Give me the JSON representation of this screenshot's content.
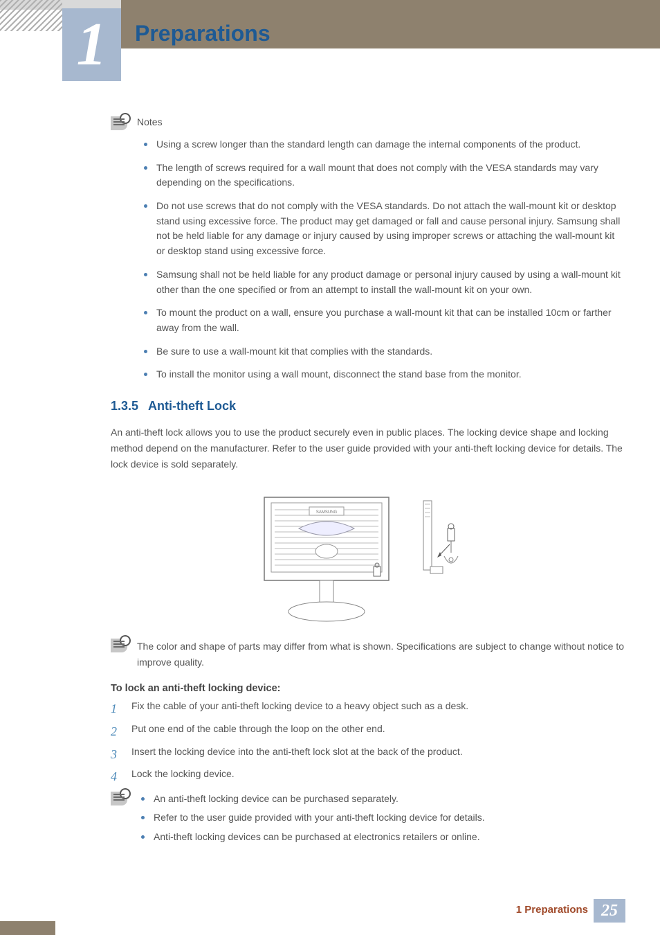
{
  "header": {
    "chapter_number": "1",
    "chapter_title": "Preparations"
  },
  "notes_block": {
    "label": "Notes",
    "icon": "note-icon",
    "items": [
      "Using a screw longer than the standard length can damage the internal components of the product.",
      "The length of screws required for a wall mount that does not comply with the VESA standards may vary depending on the specifications.",
      "Do not use screws that do not comply with the VESA standards. Do not attach the wall-mount kit or desktop stand using excessive force. The product may get damaged or fall and cause personal injury. Samsung shall not be held liable for any damage or injury caused by using improper screws or attaching the wall-mount kit or desktop stand using excessive force.",
      "Samsung shall not be held liable for any product damage or personal injury caused by using a wall-mount kit other than the one specified or from an attempt to install the wall-mount kit on your own.",
      "To mount the product on a wall, ensure you purchase a wall-mount kit that can be installed 10cm or farther away from the wall.",
      "Be sure to use a wall-mount kit that complies with the standards.",
      "To install the monitor using a wall mount, disconnect the stand base from the monitor."
    ]
  },
  "section": {
    "number": "1.3.5",
    "title": "Anti-theft Lock",
    "intro": "An anti-theft lock allows you to use the product securely even in public places. The locking device shape and locking method depend on the manufacturer. Refer to the user guide provided with your anti-theft locking device for details. The lock device is sold separately.",
    "diagram_note": "The color and shape of parts may differ from what is shown. Specifications are subject to change without notice to improve quality.",
    "subheading": "To lock an anti-theft locking device:",
    "steps": [
      {
        "n": "1",
        "t": "Fix the cable of your anti-theft locking device to a heavy object such as a desk."
      },
      {
        "n": "2",
        "t": "Put one end of the cable through the loop on the other end."
      },
      {
        "n": "3",
        "t": "Insert the locking device into the anti-theft lock slot at the back of the product."
      },
      {
        "n": "4",
        "t": "Lock the locking device."
      }
    ],
    "trailing_notes": [
      "An anti-theft locking device can be purchased separately.",
      "Refer to the user guide provided with your anti-theft locking device for details.",
      "Anti-theft locking devices can be purchased at electronics retailers or online."
    ]
  },
  "footer": {
    "label": "1 Preparations",
    "page": "25"
  }
}
